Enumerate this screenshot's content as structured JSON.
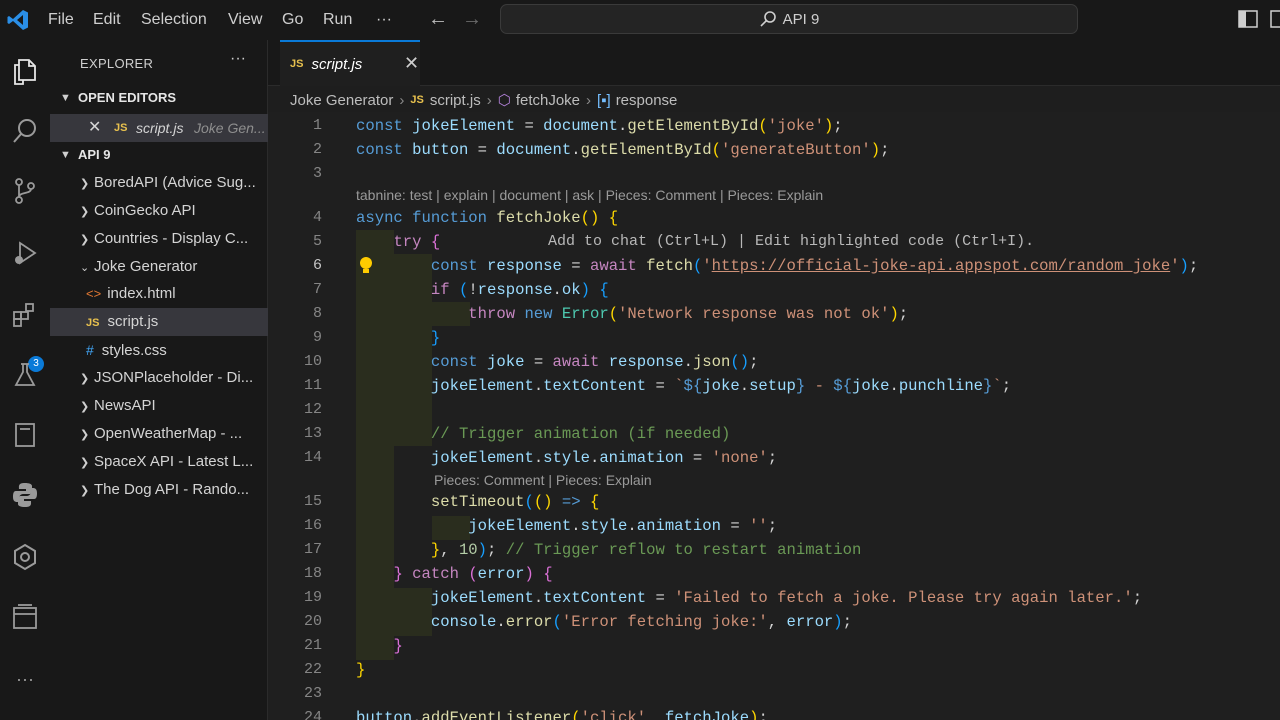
{
  "menu": [
    "File",
    "Edit",
    "Selection",
    "View",
    "Go",
    "Run",
    "···"
  ],
  "command_center": "API 9",
  "activity_badge": "3",
  "sidebar": {
    "title": "EXPLORER",
    "more": "···",
    "open_editors": {
      "heading": "OPEN EDITORS",
      "file": "script.js",
      "folder": "Joke Gen..."
    },
    "workspace": {
      "heading": "API 9",
      "items": [
        "BoredAPI (Advice Sug...",
        "CoinGecko API",
        "Countries - Display C...",
        "Joke Generator",
        "index.html",
        "script.js",
        "styles.css",
        "JSONPlaceholder - Di...",
        "NewsAPI",
        "OpenWeatherMap - ...",
        "SpaceX API - Latest L...",
        "The Dog API - Rando..."
      ]
    }
  },
  "tab": {
    "label": "script.js",
    "badge": "JS"
  },
  "breadcrumb": [
    "Joke Generator",
    "script.js",
    "fetchJoke",
    "response"
  ],
  "lens": {
    "tabnine": "tabnine: test | explain | document | ask | Pieces: Comment | Pieces: Explain",
    "pieces": "Pieces: Comment | Pieces: Explain"
  },
  "inline_hint": "Add to chat (Ctrl+L) | Edit highlighted code (Ctrl+I).",
  "line_numbers": [
    "1",
    "2",
    "3",
    "4",
    "5",
    "6",
    "7",
    "8",
    "9",
    "10",
    "11",
    "12",
    "13",
    "14",
    "15",
    "16",
    "17",
    "18",
    "19",
    "20",
    "21",
    "22",
    "23",
    "24"
  ],
  "code": {
    "l1_var": "jokeElement",
    "l1_fn": "getElementById",
    "l1_str": "'joke'",
    "l2_var": "button",
    "l2_str": "'generateButton'",
    "l4_fn": "fetchJoke",
    "l6_url": "https://official-joke-api.appspot.com/random_joke",
    "l8_str": "'Network response was not ok'",
    "l13_cm": "// Trigger animation (if needed)",
    "l14_str": "'none'",
    "l16_str": "''",
    "l17_num": "10",
    "l17_cm": "// Trigger reflow to restart animation",
    "l19_str": "'Failed to fetch a joke. Please try again later.'",
    "l20_str": "'Error fetching joke:'"
  }
}
